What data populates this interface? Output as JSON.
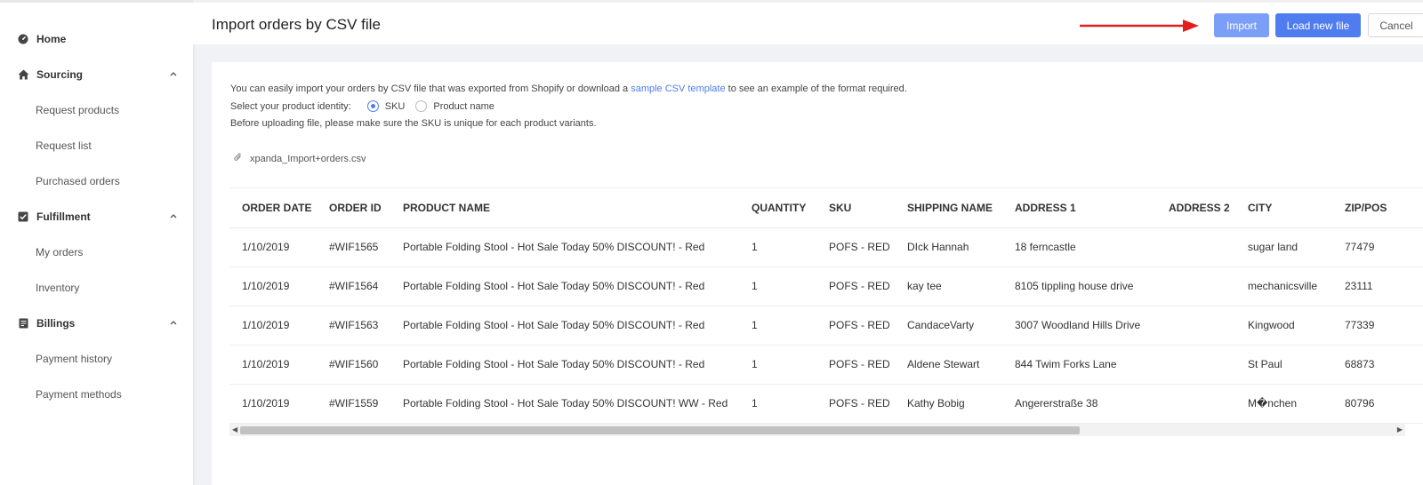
{
  "sidebar": {
    "home": "Home",
    "sourcing": {
      "label": "Sourcing",
      "items": [
        "Request products",
        "Request list",
        "Purchased orders"
      ]
    },
    "fulfillment": {
      "label": "Fulfillment",
      "items": [
        "My orders",
        "Inventory"
      ]
    },
    "billings": {
      "label": "Billings",
      "items": [
        "Payment history",
        "Payment methods"
      ]
    }
  },
  "header": {
    "title": "Import orders by CSV file",
    "import_label": "Import",
    "load_label": "Load new file",
    "cancel_label": "Cancel"
  },
  "info": {
    "line1_before": "You can easily import your orders by CSV file that was exported from Shopify or download a ",
    "line1_link": "sample CSV template",
    "line1_after": " to see an example of the format required.",
    "identity_label": "Select your product identity:",
    "identity_options": [
      "SKU",
      "Product name"
    ],
    "identity_selected": "SKU",
    "line3": "Before uploading file, please make sure the SKU is unique for each product variants.",
    "file_name": "xpanda_Import+orders.csv"
  },
  "table": {
    "columns": [
      "ORDER DATE",
      "ORDER ID",
      "PRODUCT NAME",
      "QUANTITY",
      "SKU",
      "SHIPPING NAME",
      "ADDRESS 1",
      "ADDRESS 2",
      "CITY",
      "ZIP/POS"
    ],
    "rows": [
      [
        "1/10/2019",
        "#WIF1565",
        "Portable Folding Stool - Hot Sale Today 50% DISCOUNT! - Red",
        "1",
        "POFS - RED",
        "DIck Hannah",
        "18 ferncastle",
        "",
        "sugar land",
        "77479"
      ],
      [
        "1/10/2019",
        "#WIF1564",
        "Portable Folding Stool - Hot Sale Today 50% DISCOUNT! - Red",
        "1",
        "POFS - RED",
        "kay tee",
        "8105 tippling house drive",
        "",
        "mechanicsville",
        "23111"
      ],
      [
        "1/10/2019",
        "#WIF1563",
        "Portable Folding Stool - Hot Sale Today 50% DISCOUNT! - Red",
        "1",
        "POFS - RED",
        "CandaceVarty",
        "3007 Woodland Hills Drive",
        "",
        "Kingwood",
        "77339"
      ],
      [
        "1/10/2019",
        "#WIF1560",
        "Portable Folding Stool - Hot Sale Today 50% DISCOUNT! - Red",
        "1",
        "POFS - RED",
        "Aldene Stewart",
        "844 Twim Forks Lane",
        "",
        "St Paul",
        "68873"
      ],
      [
        "1/10/2019",
        "#WIF1559",
        "Portable Folding Stool - Hot Sale Today 50% DISCOUNT! WW - Red",
        "1",
        "POFS - RED",
        "Kathy Bobig",
        "Angererstraße 38",
        "",
        "M�nchen",
        "80796"
      ]
    ]
  },
  "colors": {
    "accent": "#4f7df0",
    "import_button": "#7b9ff6",
    "arrow": "#e02020"
  }
}
